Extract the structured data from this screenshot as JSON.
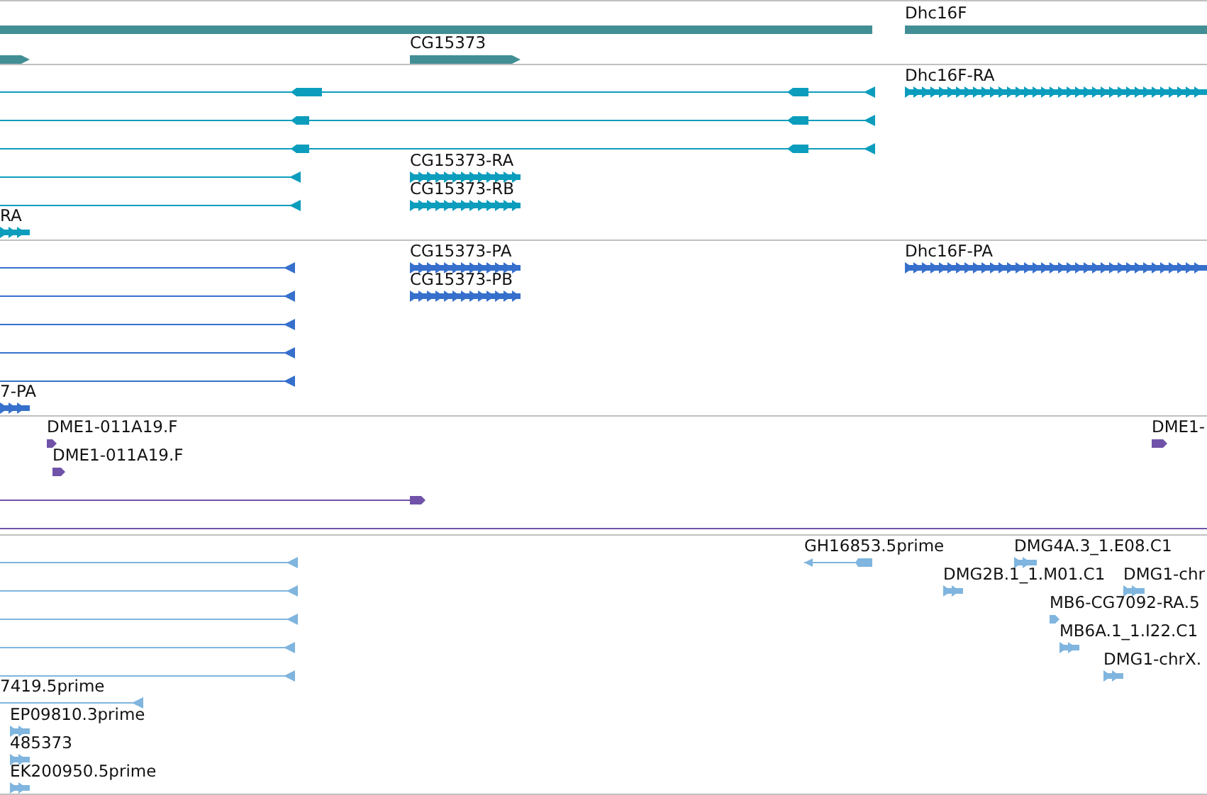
{
  "tracks": [
    {
      "color": "#418f94",
      "features": [
        {
          "kind": "bar"
        },
        {
          "label": "Dhc16F",
          "kind": "bar"
        },
        {
          "kind": "bar-forward"
        },
        {
          "label": "CG15373",
          "kind": "bar-forward"
        }
      ]
    },
    {
      "color": "#0c9dbd",
      "features": [
        {
          "kind": "reverse-line"
        },
        {
          "kind": "reverse-line"
        },
        {
          "kind": "reverse-line"
        },
        {
          "kind": "reverse-line"
        },
        {
          "kind": "reverse-line"
        },
        {
          "label": "Dhc16F-RA",
          "kind": "arrows"
        },
        {
          "label": "CG15373-RA",
          "kind": "arrows"
        },
        {
          "label": "CG15373-RB",
          "kind": "arrows"
        },
        {
          "label": "RA",
          "kind": "arrows"
        }
      ]
    },
    {
      "color": "#3670cc",
      "features": [
        {
          "kind": "reverse-line"
        },
        {
          "kind": "reverse-line"
        },
        {
          "kind": "reverse-line"
        },
        {
          "kind": "reverse-line"
        },
        {
          "kind": "reverse-line"
        },
        {
          "label": "CG15373-PA",
          "kind": "arrows"
        },
        {
          "label": "CG15373-PB",
          "kind": "arrows"
        },
        {
          "label": "Dhc16F-PA",
          "kind": "arrows"
        },
        {
          "label": "7-PA",
          "kind": "arrows"
        }
      ]
    },
    {
      "color": "#7052a8",
      "features": [
        {
          "label": "DME1-011A19.F",
          "kind": "marker"
        },
        {
          "label": "DME1-011A19.F",
          "kind": "marker"
        },
        {
          "kind": "forward-line"
        },
        {
          "kind": "plain-line"
        },
        {
          "label": "DME1-",
          "kind": "marker"
        }
      ]
    },
    {
      "color": "#7fb5de",
      "features": [
        {
          "kind": "reverse-line"
        },
        {
          "kind": "reverse-line"
        },
        {
          "kind": "reverse-line"
        },
        {
          "kind": "reverse-line"
        },
        {
          "kind": "reverse-line"
        },
        {
          "label": "GH16853.5prime",
          "kind": "span"
        },
        {
          "label": "DMG4A.3_1.E08.C1",
          "kind": "arrows"
        },
        {
          "label": "DMG2B.1_1.M01.C1",
          "kind": "arrows"
        },
        {
          "label": "DMG1-chr",
          "kind": "arrows"
        },
        {
          "label": "MB6-CG7092-RA.5",
          "kind": "marker"
        },
        {
          "label": "MB6A.1_1.I22.C1",
          "kind": "arrows"
        },
        {
          "label": "DMG1-chrX.",
          "kind": "arrows"
        },
        {
          "label": "7419.5prime",
          "kind": "reverse-line"
        },
        {
          "label": "EP09810.3prime",
          "kind": "arrows"
        },
        {
          "label": "485373",
          "kind": "arrows"
        },
        {
          "label": "EK200950.5prime",
          "kind": "arrows"
        }
      ]
    }
  ]
}
